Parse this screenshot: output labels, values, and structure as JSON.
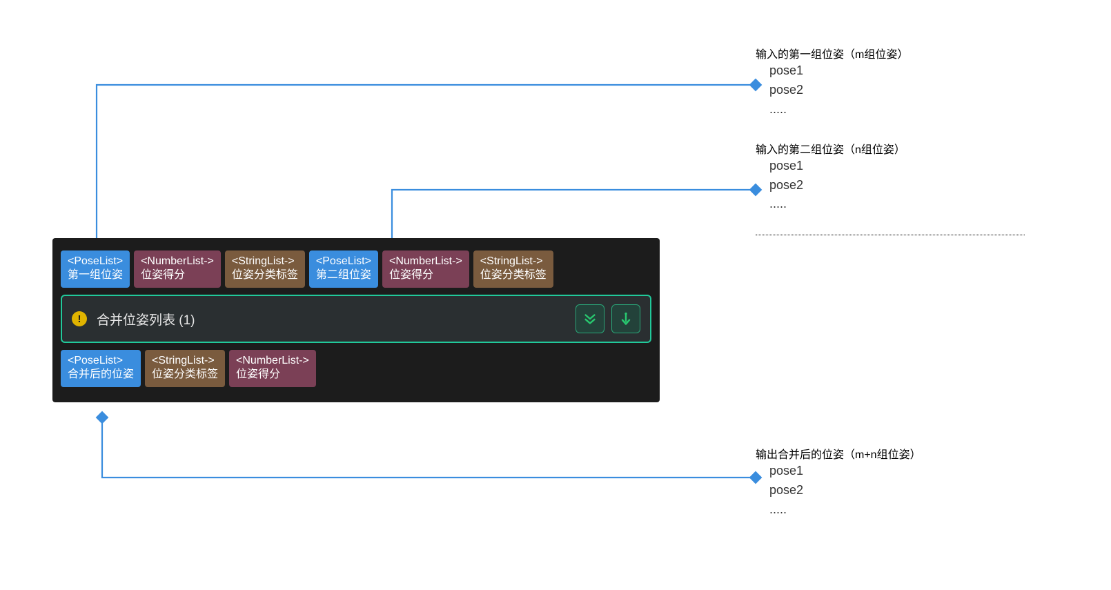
{
  "node": {
    "title": "合并位姿列表 (1)",
    "inputs": [
      {
        "type": "<PoseList>",
        "label": "第一组位姿"
      },
      {
        "type": "<NumberList->",
        "label": "位姿得分"
      },
      {
        "type": "<StringList->",
        "label": "位姿分类标签"
      },
      {
        "type": "<PoseList>",
        "label": "第二组位姿"
      },
      {
        "type": "<NumberList->",
        "label": "位姿得分"
      },
      {
        "type": "<StringList->",
        "label": "位姿分类标签"
      }
    ],
    "outputs": [
      {
        "type": "<PoseList>",
        "label": "合并后的位姿"
      },
      {
        "type": "<StringList->",
        "label": "位姿分类标签"
      },
      {
        "type": "<NumberList->",
        "label": "位姿得分"
      }
    ],
    "warn_glyph": "!",
    "icons": {
      "expand": "expand-down-icon",
      "collapse": "collapse-down-icon"
    }
  },
  "annotations": {
    "block1": {
      "title": "输入的第一组位姿（m组位姿）",
      "lines": [
        "pose1",
        "pose2",
        "....."
      ]
    },
    "block2": {
      "title": "输入的第二组位姿（n组位姿）",
      "lines": [
        "pose1",
        "pose2",
        "....."
      ]
    },
    "block3": {
      "title": "输出合并后的位姿（m+n组位姿）",
      "lines": [
        "pose1",
        "pose2",
        "....."
      ]
    }
  },
  "colors": {
    "connector": "#3A8DDE",
    "node_border": "#21C99A",
    "warn": "#E0B400",
    "green": "#28C76F"
  }
}
